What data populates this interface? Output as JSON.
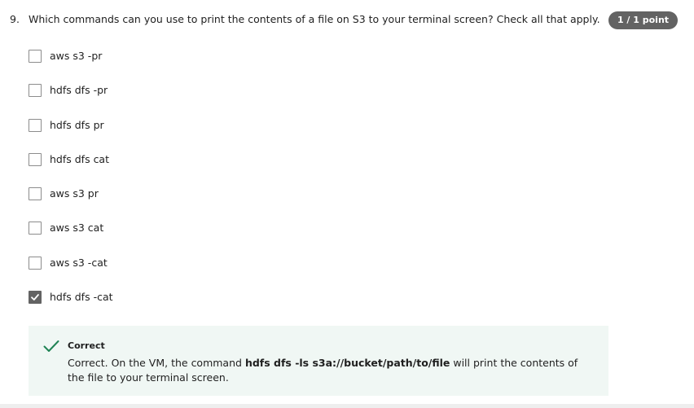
{
  "question": {
    "number": "9.",
    "text": "Which commands can you use to print the contents of a file on S3 to your terminal screen? Check all that apply.",
    "points": "1 / 1 point"
  },
  "options": [
    {
      "label": "aws s3 -pr",
      "checked": false
    },
    {
      "label": "hdfs dfs -pr",
      "checked": false
    },
    {
      "label": "hdfs dfs pr",
      "checked": false
    },
    {
      "label": "hdfs dfs cat",
      "checked": false
    },
    {
      "label": "aws s3 pr",
      "checked": false
    },
    {
      "label": "aws s3 cat",
      "checked": false
    },
    {
      "label": "aws s3 -cat",
      "checked": false
    },
    {
      "label": "hdfs dfs -cat",
      "checked": true
    }
  ],
  "feedback": {
    "status": "Correct",
    "text_before": "Correct. On the VM, the command ",
    "command": "hdfs dfs -ls s3a://bucket/path/to/file",
    "text_after": " will print the contents of the file to your terminal screen.",
    "icon": "checkmark-icon",
    "accent_color": "#1f8354",
    "background_color": "#f0f7f4"
  },
  "colors": {
    "badge_background": "#636363",
    "checkbox_checked": "#636363"
  }
}
